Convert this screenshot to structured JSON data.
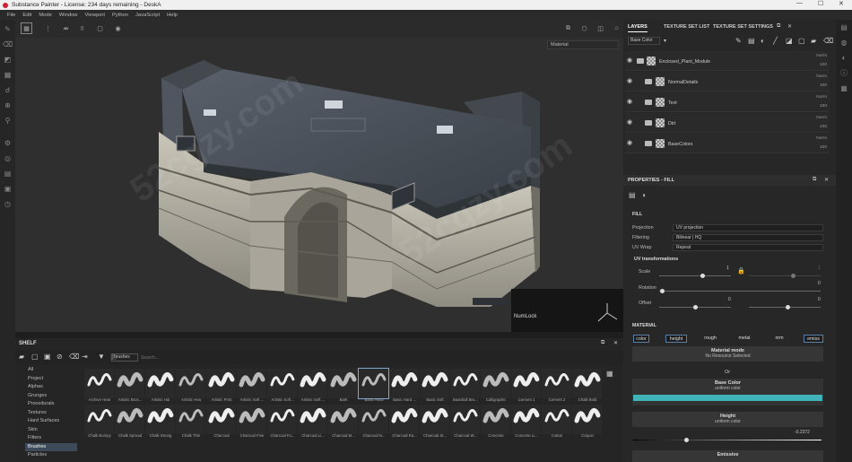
{
  "window": {
    "title": "Substance Painter - License: 234 days remaining - DeskA",
    "minimize": "—",
    "maximize": "☐",
    "close": "✕"
  },
  "menu": [
    "File",
    "Edit",
    "Mode",
    "Window",
    "Viewport",
    "Python",
    "JavaScript",
    "Help"
  ],
  "viewport": {
    "mode_select": "Material",
    "overlay_text": "NumLock"
  },
  "shelf": {
    "title": "SHELF",
    "filter_tag": "brushes",
    "search_placeholder": "Search...",
    "categories": [
      "All",
      "Project",
      "Alphas",
      "Grunges",
      "Procedurals",
      "Textures",
      "Hard Surfaces",
      "Skin",
      "Filters",
      "Brushes",
      "Particles"
    ],
    "selected_category": "Brushes",
    "brushes_row1": [
      "Archive Hear",
      "Artistic Brus...",
      "Artistic Hai",
      "Artistic Hea",
      "Artistic Print",
      "Artistic Soft ...",
      "Artistic Soft...",
      "Artistic Soft ...",
      "Bark",
      "Basic Hard",
      "Basic Hard ...",
      "Basic Soft",
      "Baseball Bru...",
      "Calligraphic",
      "Cement 1",
      "Cement 2",
      "Chalk Bold"
    ],
    "brushes_row2": [
      "Chalk Bumpy",
      "Chalk Spread",
      "Chalk Strong",
      "Chalk Thin",
      "Charcoal",
      "Charcoal Fine",
      "Charcoal Fu...",
      "Charcoal Li...",
      "Charcoal M...",
      "Charcoal N...",
      "Charcoal Ra...",
      "Charcoal St...",
      "Charcoal W...",
      "Concrete",
      "Concrete Li...",
      "Cotton",
      "Crayon"
    ]
  },
  "tabs": [
    "LAYERS",
    "TEXTURE SET LIST",
    "TEXTURE SET SETTINGS"
  ],
  "layers": {
    "channel_select": "Base Color",
    "items": [
      {
        "name": "Enclosed_Plant_Module",
        "blend": "Norm",
        "opacity": "100"
      },
      {
        "name": "NormalDetails",
        "blend": "Norm",
        "opacity": "100"
      },
      {
        "name": "Text",
        "blend": "Norm",
        "opacity": "100"
      },
      {
        "name": "Dirt",
        "blend": "Norm",
        "opacity": "100"
      },
      {
        "name": "BaseColors",
        "blend": "Norm",
        "opacity": "100"
      }
    ]
  },
  "properties": {
    "title": "PROPERTIES - FILL",
    "section_fill": "FILL",
    "projection_label": "Projection",
    "projection_value": "UV projection",
    "filtering_label": "Filtering",
    "filtering_value": "Bilinear | HQ",
    "uvwrap_label": "UV Wrap",
    "uvwrap_value": "Repeat",
    "uv_transformations": "UV transformations",
    "scale_label": "Scale",
    "scale_value": "1",
    "scale_value2": "1",
    "rotation_label": "Rotation",
    "rotation_value": "0",
    "offset_label": "Offset",
    "offset_value": "0",
    "offset_value2": "0",
    "section_material": "MATERIAL",
    "channels": [
      "color",
      "height",
      "rough",
      "metal",
      "nrm",
      "emiss"
    ],
    "material_mode_label": "Material mode",
    "material_mode_value": "No Resource Selected",
    "or": "Or",
    "base_color_label": "Base Color",
    "base_color_sub": "uniform color",
    "base_color_hex": "#3fb3b8",
    "height_label": "Height",
    "height_sub": "uniform color",
    "height_value": "-0.2372",
    "emissive_label": "Emissive"
  },
  "watermark": "52cgzy.com"
}
